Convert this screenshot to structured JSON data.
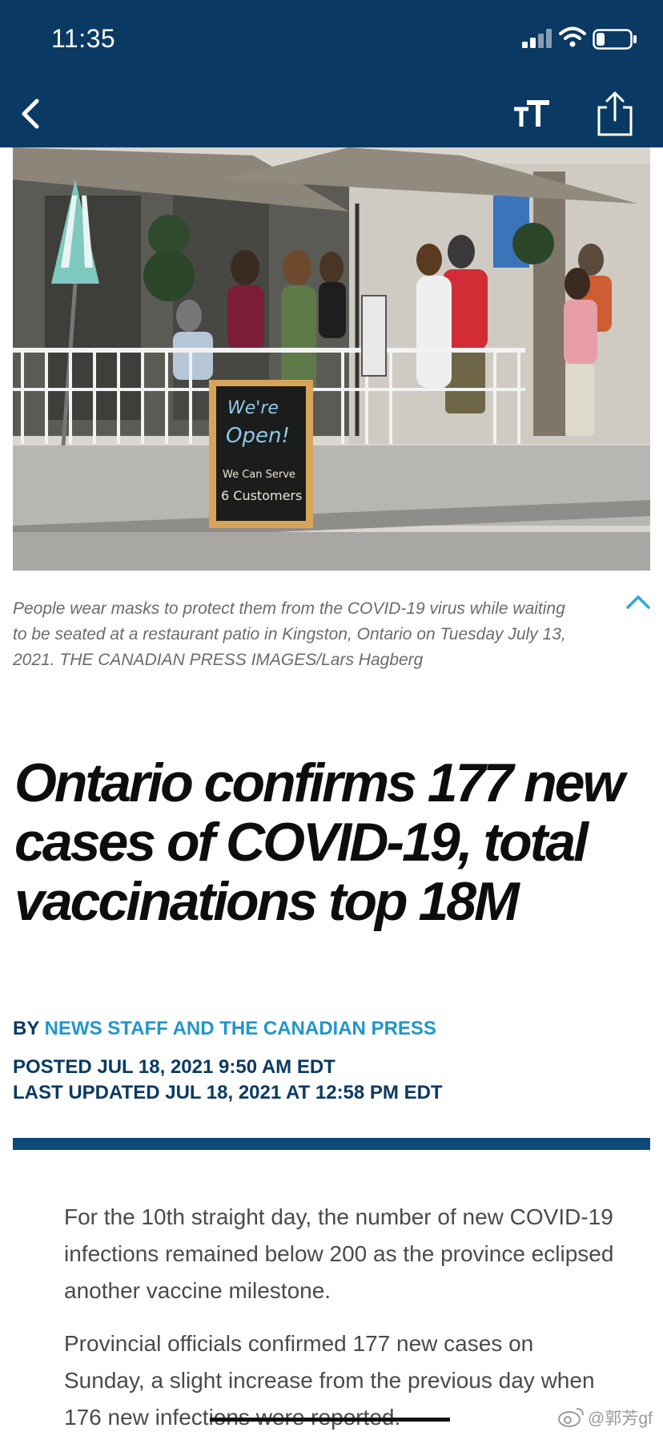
{
  "status_bar": {
    "time": "11:35"
  },
  "photo": {
    "sign_line1": "We're",
    "sign_line2": "Open!",
    "sign_line3": "We Can Serve",
    "sign_line4": "6 Customers"
  },
  "caption": "People wear masks to protect them from the COVID-19 virus while waiting to be seated at a restaurant patio in Kingston, Ontario on Tuesday July 13, 2021. THE CANADIAN PRESS IMAGES/Lars Hagberg",
  "headline": "Ontario confirms 177 new cases of COVID-19, total vaccinations top 18M",
  "byline": {
    "prefix": "BY",
    "author": "NEWS STAFF AND THE CANADIAN PRESS"
  },
  "posted": "POSTED JUL 18, 2021 9:50 AM EDT",
  "updated": "LAST UPDATED JUL 18, 2021 AT 12:58 PM EDT",
  "body": {
    "p1": "For the 10th straight day, the number of new COVID-19 infections remained below 200 as the province eclipsed another vaccine milestone.",
    "p2": "Provincial officials confirmed 177 new cases on Sunday, a slight increase from the previous day when 176 new infections were reported."
  },
  "watermark": {
    "handle": "@郭芳gf"
  },
  "colors": {
    "nav": "#0a3a63",
    "accent": "#2196c9",
    "rule": "#0d4a78"
  },
  "icons": [
    "back-arrow-icon",
    "text-size-icon",
    "share-icon",
    "collapse-caption-icon",
    "signal-icon",
    "wifi-icon",
    "battery-icon",
    "weibo-logo"
  ]
}
